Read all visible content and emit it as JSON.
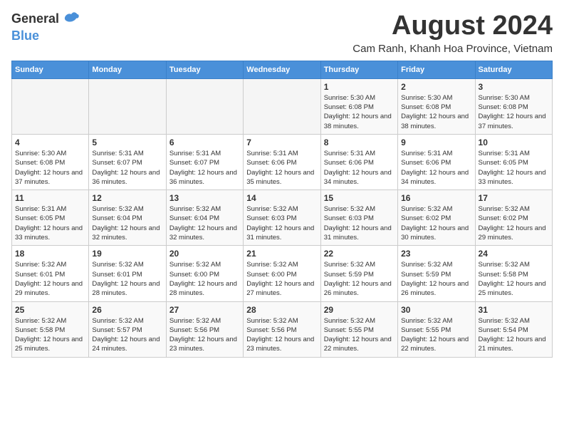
{
  "logo": {
    "general": "General",
    "blue": "Blue"
  },
  "title": "August 2024",
  "subtitle": "Cam Ranh, Khanh Hoa Province, Vietnam",
  "days": [
    "Sunday",
    "Monday",
    "Tuesday",
    "Wednesday",
    "Thursday",
    "Friday",
    "Saturday"
  ],
  "weeks": [
    [
      {
        "date": "",
        "info": ""
      },
      {
        "date": "",
        "info": ""
      },
      {
        "date": "",
        "info": ""
      },
      {
        "date": "",
        "info": ""
      },
      {
        "date": "1",
        "info": "Sunrise: 5:30 AM\nSunset: 6:08 PM\nDaylight: 12 hours\nand 38 minutes."
      },
      {
        "date": "2",
        "info": "Sunrise: 5:30 AM\nSunset: 6:08 PM\nDaylight: 12 hours\nand 38 minutes."
      },
      {
        "date": "3",
        "info": "Sunrise: 5:30 AM\nSunset: 6:08 PM\nDaylight: 12 hours\nand 37 minutes."
      }
    ],
    [
      {
        "date": "4",
        "info": "Sunrise: 5:30 AM\nSunset: 6:08 PM\nDaylight: 12 hours\nand 37 minutes."
      },
      {
        "date": "5",
        "info": "Sunrise: 5:31 AM\nSunset: 6:07 PM\nDaylight: 12 hours\nand 36 minutes."
      },
      {
        "date": "6",
        "info": "Sunrise: 5:31 AM\nSunset: 6:07 PM\nDaylight: 12 hours\nand 36 minutes."
      },
      {
        "date": "7",
        "info": "Sunrise: 5:31 AM\nSunset: 6:06 PM\nDaylight: 12 hours\nand 35 minutes."
      },
      {
        "date": "8",
        "info": "Sunrise: 5:31 AM\nSunset: 6:06 PM\nDaylight: 12 hours\nand 34 minutes."
      },
      {
        "date": "9",
        "info": "Sunrise: 5:31 AM\nSunset: 6:06 PM\nDaylight: 12 hours\nand 34 minutes."
      },
      {
        "date": "10",
        "info": "Sunrise: 5:31 AM\nSunset: 6:05 PM\nDaylight: 12 hours\nand 33 minutes."
      }
    ],
    [
      {
        "date": "11",
        "info": "Sunrise: 5:31 AM\nSunset: 6:05 PM\nDaylight: 12 hours\nand 33 minutes."
      },
      {
        "date": "12",
        "info": "Sunrise: 5:32 AM\nSunset: 6:04 PM\nDaylight: 12 hours\nand 32 minutes."
      },
      {
        "date": "13",
        "info": "Sunrise: 5:32 AM\nSunset: 6:04 PM\nDaylight: 12 hours\nand 32 minutes."
      },
      {
        "date": "14",
        "info": "Sunrise: 5:32 AM\nSunset: 6:03 PM\nDaylight: 12 hours\nand 31 minutes."
      },
      {
        "date": "15",
        "info": "Sunrise: 5:32 AM\nSunset: 6:03 PM\nDaylight: 12 hours\nand 31 minutes."
      },
      {
        "date": "16",
        "info": "Sunrise: 5:32 AM\nSunset: 6:02 PM\nDaylight: 12 hours\nand 30 minutes."
      },
      {
        "date": "17",
        "info": "Sunrise: 5:32 AM\nSunset: 6:02 PM\nDaylight: 12 hours\nand 29 minutes."
      }
    ],
    [
      {
        "date": "18",
        "info": "Sunrise: 5:32 AM\nSunset: 6:01 PM\nDaylight: 12 hours\nand 29 minutes."
      },
      {
        "date": "19",
        "info": "Sunrise: 5:32 AM\nSunset: 6:01 PM\nDaylight: 12 hours\nand 28 minutes."
      },
      {
        "date": "20",
        "info": "Sunrise: 5:32 AM\nSunset: 6:00 PM\nDaylight: 12 hours\nand 28 minutes."
      },
      {
        "date": "21",
        "info": "Sunrise: 5:32 AM\nSunset: 6:00 PM\nDaylight: 12 hours\nand 27 minutes."
      },
      {
        "date": "22",
        "info": "Sunrise: 5:32 AM\nSunset: 5:59 PM\nDaylight: 12 hours\nand 26 minutes."
      },
      {
        "date": "23",
        "info": "Sunrise: 5:32 AM\nSunset: 5:59 PM\nDaylight: 12 hours\nand 26 minutes."
      },
      {
        "date": "24",
        "info": "Sunrise: 5:32 AM\nSunset: 5:58 PM\nDaylight: 12 hours\nand 25 minutes."
      }
    ],
    [
      {
        "date": "25",
        "info": "Sunrise: 5:32 AM\nSunset: 5:58 PM\nDaylight: 12 hours\nand 25 minutes."
      },
      {
        "date": "26",
        "info": "Sunrise: 5:32 AM\nSunset: 5:57 PM\nDaylight: 12 hours\nand 24 minutes."
      },
      {
        "date": "27",
        "info": "Sunrise: 5:32 AM\nSunset: 5:56 PM\nDaylight: 12 hours\nand 23 minutes."
      },
      {
        "date": "28",
        "info": "Sunrise: 5:32 AM\nSunset: 5:56 PM\nDaylight: 12 hours\nand 23 minutes."
      },
      {
        "date": "29",
        "info": "Sunrise: 5:32 AM\nSunset: 5:55 PM\nDaylight: 12 hours\nand 22 minutes."
      },
      {
        "date": "30",
        "info": "Sunrise: 5:32 AM\nSunset: 5:55 PM\nDaylight: 12 hours\nand 22 minutes."
      },
      {
        "date": "31",
        "info": "Sunrise: 5:32 AM\nSunset: 5:54 PM\nDaylight: 12 hours\nand 21 minutes."
      }
    ]
  ]
}
